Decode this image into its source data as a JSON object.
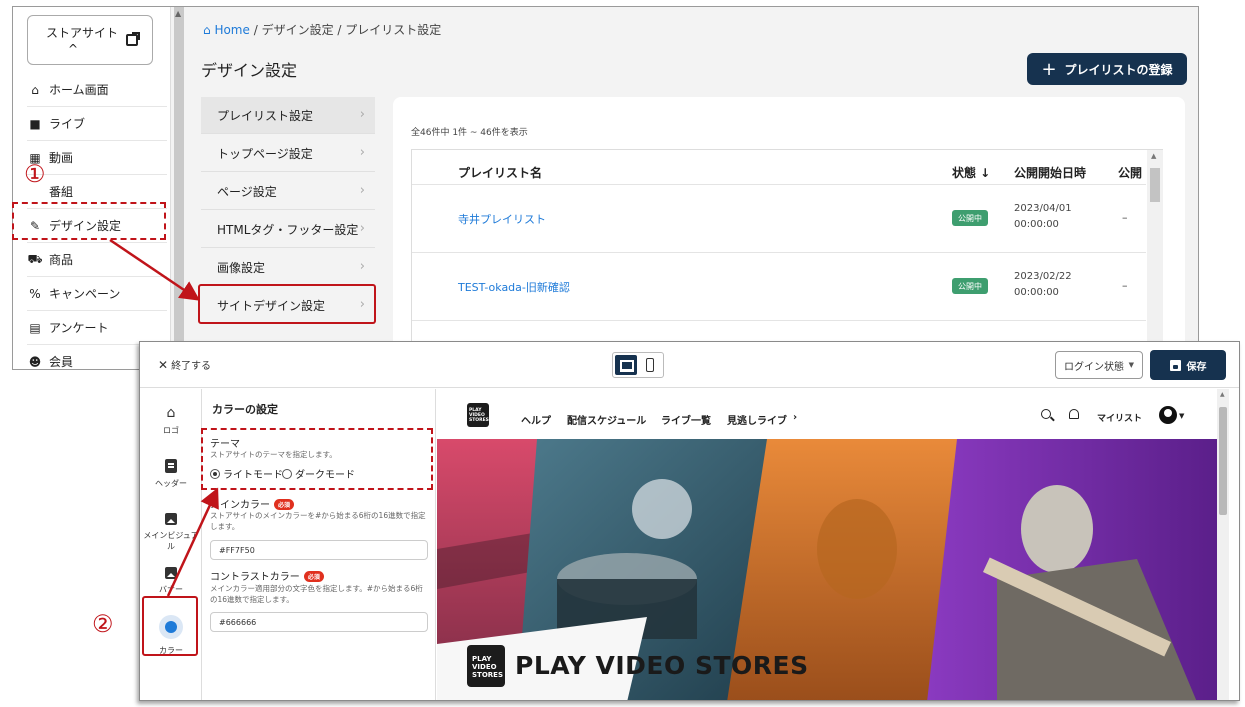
{
  "admin": {
    "store_site": "ストアサイト",
    "store_chevron": "^",
    "nav": [
      {
        "icon": "home-icon",
        "glyph": "⌂",
        "label": "ホーム画面"
      },
      {
        "icon": "video-camera-icon",
        "glyph": "■",
        "label": "ライブ"
      },
      {
        "icon": "video-icon",
        "glyph": "▦",
        "label": "動画"
      },
      {
        "icon": "program-icon",
        "glyph": "",
        "label": "番組"
      },
      {
        "icon": "brush-icon",
        "glyph": "✎",
        "label": "デザイン設定"
      },
      {
        "icon": "cart-icon",
        "glyph": "⛟",
        "label": "商品"
      },
      {
        "icon": "percent-icon",
        "glyph": "%",
        "label": "キャンペーン"
      },
      {
        "icon": "survey-icon",
        "glyph": "▤",
        "label": "アンケート"
      },
      {
        "icon": "members-icon",
        "glyph": "☻",
        "label": "会員"
      }
    ],
    "breadcrumb": {
      "home": "Home",
      "sep": "/",
      "design": "デザイン設定",
      "current": "プレイリスト設定"
    },
    "page_title": "デザイン設定",
    "add_button": "プレイリストの登録",
    "subnav": [
      "プレイリスト設定",
      "トップページ設定",
      "ページ設定",
      "HTMLタグ・フッター設定",
      "画像設定",
      "サイトデザイン設定"
    ],
    "result_count": "全46件中 1件 ~ 46件を表示",
    "table": {
      "columns": [
        "プレイリスト名",
        "状態 ↓",
        "公開開始日時",
        "公開"
      ],
      "rows": [
        {
          "name": "寺井プレイリスト",
          "status": "公開中",
          "date": "2023/04/01",
          "time": "00:00:00",
          "end": "–"
        },
        {
          "name": "TEST-okada-旧新確認",
          "status": "公開中",
          "date": "2023/02/22",
          "time": "00:00:00",
          "end": "–"
        }
      ]
    }
  },
  "editor": {
    "exit_label": "終了する",
    "login_select": "ログイン状態",
    "save_label": "保存",
    "rail": [
      {
        "icon": "home-icon",
        "label": "ロゴ"
      },
      {
        "icon": "header-icon",
        "label": "ヘッダー"
      },
      {
        "icon": "image-icon",
        "label": "メインビジュアル"
      },
      {
        "icon": "banner-icon",
        "label": "バナー"
      },
      {
        "icon": "palette-icon",
        "label": "カラー"
      }
    ],
    "panel": {
      "title": "カラーの設定",
      "theme_label": "テーマ",
      "theme_desc": "ストアサイトのテーマを指定します。",
      "theme_options": [
        "ライトモード",
        "ダークモード"
      ],
      "theme_selected": "ライトモード",
      "main_color_label": "メインカラー",
      "required": "必須",
      "main_color_desc": "ストアサイトのメインカラーを#から始まる6桁の16進数で指定します。",
      "main_color_value": "#FF7F50",
      "contrast_label": "コントラストカラー",
      "contrast_desc": "メインカラー適用部分の文字色を指定します。#から始まる6桁の16進数で指定します。",
      "contrast_value": "#666666"
    },
    "preview": {
      "nav": [
        "ヘルプ",
        "配信スケジュール",
        "ライブ一覧",
        "見逃しライブ"
      ],
      "nav_more": "›",
      "mylist": "マイリスト",
      "logo_text": "PLAY VIDEO STORES",
      "brand": "PLAY VIDEO STORES"
    }
  },
  "annotations": {
    "step1": "①",
    "step2": "②"
  },
  "colors": {
    "accent": "#16324f",
    "link": "#1e7ad8",
    "annotation": "#c0141a",
    "published": "#3e9e6f"
  }
}
